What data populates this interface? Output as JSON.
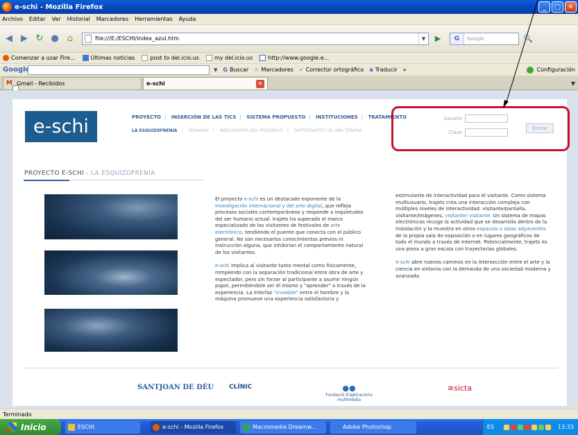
{
  "window": {
    "title": "e-schi - Mozilla Firefox"
  },
  "menu": [
    "Archivo",
    "Editar",
    "Ver",
    "Historial",
    "Marcadores",
    "Herramientas",
    "Ayuda"
  ],
  "address": {
    "url": "file:///E:/ESCHI/index_azul.htm"
  },
  "search": {
    "placeholder": "Google"
  },
  "bookmarks": [
    {
      "label": "Comenzar a usar Fire...",
      "icon": "firefox-icon"
    },
    {
      "label": "Últimas noticias",
      "icon": "rss-icon"
    },
    {
      "label": "post to del.icio.us",
      "icon": "page-icon"
    },
    {
      "label": "my del.icio.us",
      "icon": "page-icon"
    },
    {
      "label": "http://www.google.e...",
      "icon": "google-icon"
    }
  ],
  "google_toolbar": {
    "logo": "Google",
    "buscar": "Buscar",
    "marcadores": "Marcadores",
    "corrector": "Corrector ortográfico",
    "traducir": "Traducir",
    "more": "»",
    "config": "Configuración"
  },
  "tabs": [
    {
      "label": "Gmail - Recibidos"
    },
    {
      "label": "e-schi"
    }
  ],
  "site": {
    "logo": "e-schi",
    "nav_main": [
      "PROYECTO",
      "INSERCIÓN DE LAS TICS",
      "SISTEMA PROPUESTO",
      "INSTITUCIONES",
      "TRATAMIENTO"
    ],
    "nav_sub": [
      "LA ESQUIZOFRENIA",
      "PERARIAS",
      "INDICADORES DEL PROGRESO",
      "PARTICIPANTES DE UNA TERAPIA"
    ],
    "login": {
      "user_label": "Usuario",
      "pass_label": "Clave",
      "button": "Entrar"
    },
    "section_title": "PROYECTO E-SCHI",
    "section_sub": "- LA ESQUIZOFRENIA",
    "col1_p1_a": "El proyecto ",
    "col1_p1_b": "e-schi",
    "col1_p1_c": " es un destacado exponente de la ",
    "col1_p1_d": "investigación internacional y del arte digital",
    "col1_p1_e": ", que refleja procesos sociales contemporáneos y responde a inquietudes del ser humano actual. trajets ha superado el marco especializado de los visitantes de festivales de ",
    "col1_p1_f": "arte electrónico",
    "col1_p1_g": ", tendiendo el puente que conecta con el público general. No son necesarios conocimientos previos ni instrucción alguna, que inhibirían el comportamiento natural de los visitantes.",
    "col1_p2_a": "e-schi",
    "col1_p2_b": " implica al visitante tanto mental como físicamente, rompiendo con la separación tradicional entre obra de arte y espectador, pero sin forzar al participante a asumir ningún papel, permitiéndole ser él mismo y \"aprender\" a través de la experiencia. La interfaz ",
    "col1_p2_c": "\"invisible\"",
    "col1_p2_d": " entre el hombre y la máquina promueve una experiencia satisfactoria y",
    "col2_p1_a": "estimulante de interactividad para el visitante. Como sistema multiusuario, trajets crea una interacción compleja con múltiples niveles de interactividad: visitante/pantalla, visitante/imágenes, ",
    "col2_p1_b": "visitante/ visitante",
    "col2_p1_c": ". Un sistema de mapas electrónicos recoge la actividad que se desarrolla dentro de la instalación y la muestra en otros ",
    "col2_p1_d": "espacios o salas adyacentes",
    "col2_p1_e": " de la propia sala de exposición o en lugares geográficos de todo el mundo a través de Internet. Potencialmente, trajets es una pieza a gran escala con trayectorias globales.",
    "col2_p2_a": "e-schi",
    "col2_p2_b": " abre nuevos caminos en la intersección entre el arte y la ciencia en sintonía con la demanda de una sociedad moderna y avanzada.",
    "sponsors": [
      "SANTJOAN DE DÉU",
      "CLÍNIC",
      "Fundació d'aplicacions multimèdia",
      "sicta"
    ]
  },
  "status": "Terminado",
  "taskbar": {
    "start": "Inicio",
    "tasks": [
      "ESCHI",
      "e-schi - Mozilla Firefox",
      "Macromedia Dreamw...",
      "Adobe Photoshop"
    ],
    "lang": "ES",
    "clock": "13:33"
  },
  "colors": {
    "accent": "#1d5c8f",
    "highlight_box": "#c8102e",
    "link": "#2b7fc4"
  }
}
